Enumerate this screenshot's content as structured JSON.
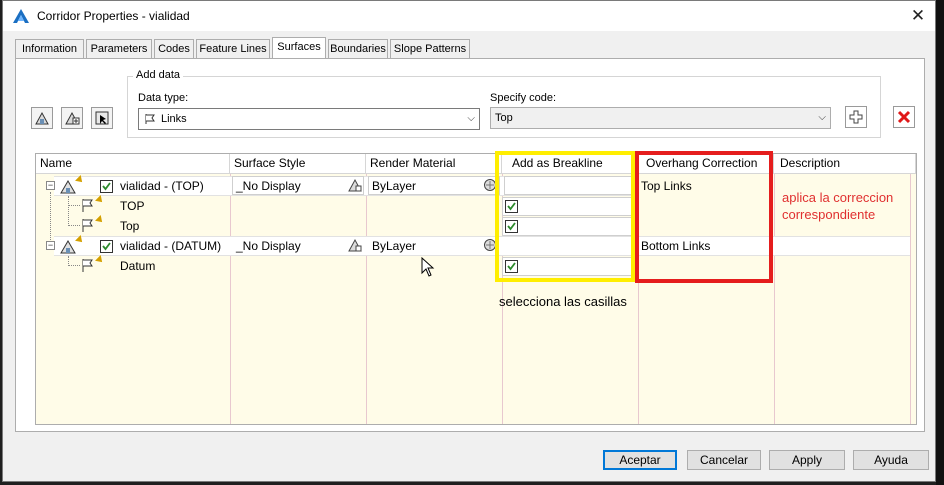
{
  "window": {
    "title": "Corridor Properties - vialidad",
    "close_glyph": "✕"
  },
  "tabs": [
    {
      "label": "Information"
    },
    {
      "label": "Parameters"
    },
    {
      "label": "Codes"
    },
    {
      "label": "Feature Lines"
    },
    {
      "label": "Surfaces",
      "active": true
    },
    {
      "label": "Boundaries"
    },
    {
      "label": "Slope Patterns"
    }
  ],
  "toolbar": {
    "icons": [
      "create-surface-icon",
      "add-surface-items-icon",
      "pick-surface-icon"
    ]
  },
  "add_data": {
    "group_label": "Add data",
    "data_type_label": "Data type:",
    "data_type_value": "Links",
    "specify_code_label": "Specify code:",
    "specify_code_value": "Top",
    "add_icon": "plus-icon",
    "remove_icon": "red-x-icon"
  },
  "grid": {
    "columns": [
      "Name",
      "Surface Style",
      "Render Material",
      "Add as Breakline",
      "Overhang Correction",
      "Description"
    ],
    "rows": [
      {
        "name": "vialidad - (TOP)",
        "style": "_No Display",
        "material": "ByLayer",
        "overhang": "Top Links",
        "level": 0,
        "checked": true
      },
      {
        "name": "TOP",
        "level": 1,
        "breakline": true
      },
      {
        "name": "Top",
        "level": 1,
        "breakline": true
      },
      {
        "name": "vialidad - (DATUM)",
        "style": "_No Display",
        "material": "ByLayer",
        "overhang": "Bottom Links",
        "level": 0,
        "checked": true
      },
      {
        "name": "Datum",
        "level": 1,
        "breakline": true
      }
    ]
  },
  "annotations": {
    "red_note": "aplica la correccion correspondiente",
    "yellow_note": "selecciona las casillas",
    "yellow_color": "#ffee00",
    "red_color": "#e51d1d"
  },
  "buttons": {
    "accept": "Aceptar",
    "cancel": "Cancelar",
    "apply": "Apply",
    "help": "Ayuda"
  }
}
